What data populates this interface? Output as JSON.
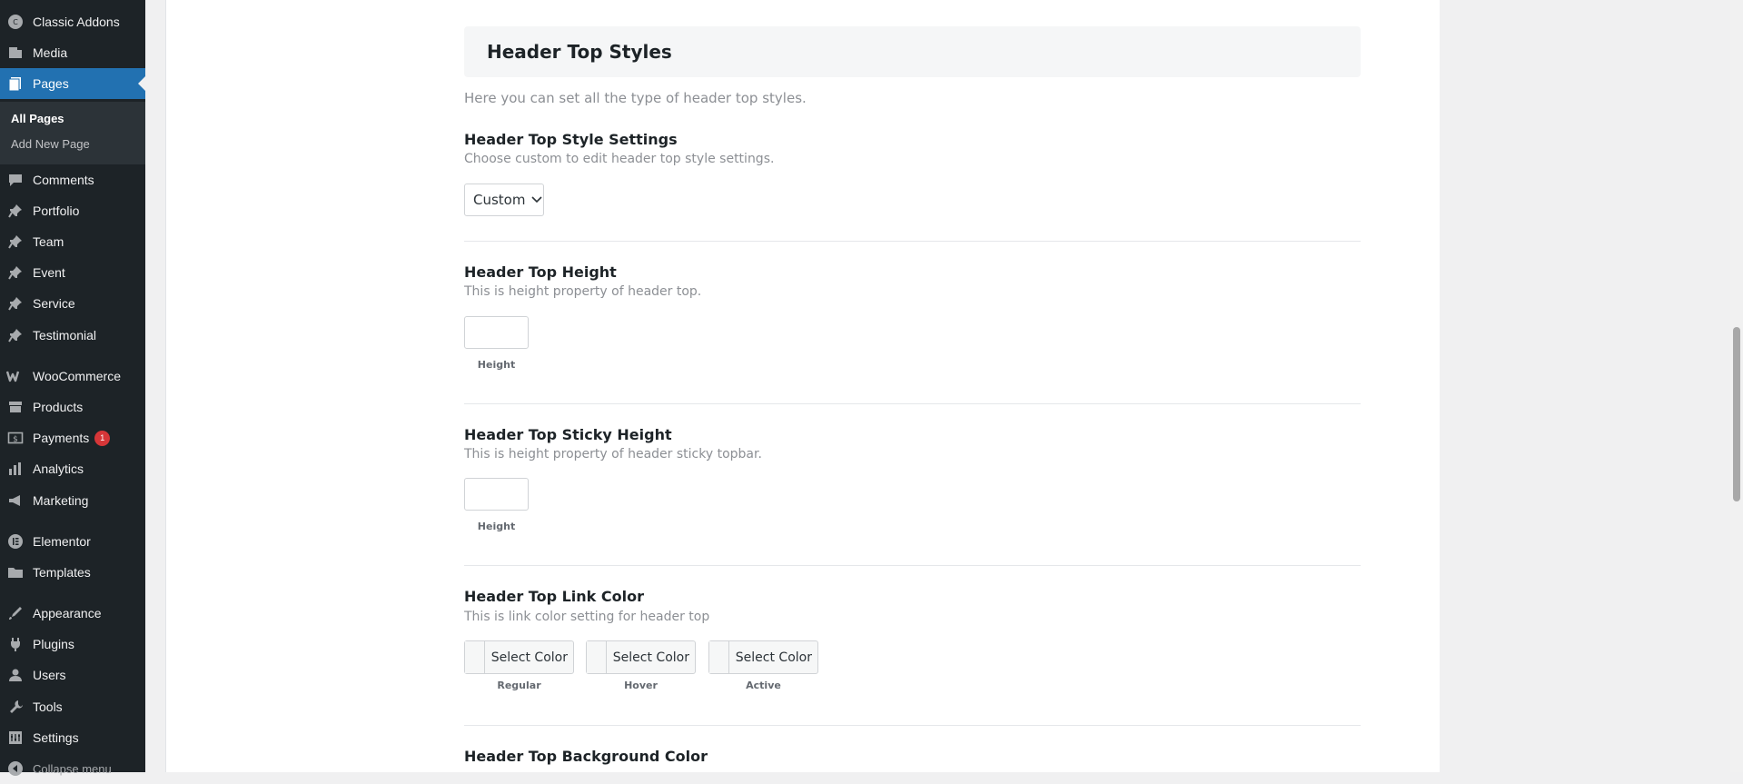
{
  "sidebar": {
    "items": [
      {
        "label": "Classic Addons",
        "icon": "classic-addons-icon"
      },
      {
        "label": "Media",
        "icon": "media-icon"
      },
      {
        "label": "Pages",
        "icon": "pages-icon",
        "active": true
      },
      {
        "label": "Comments",
        "icon": "comments-icon"
      },
      {
        "label": "Portfolio",
        "icon": "pin-icon"
      },
      {
        "label": "Team",
        "icon": "pin-icon"
      },
      {
        "label": "Event",
        "icon": "pin-icon"
      },
      {
        "label": "Service",
        "icon": "pin-icon"
      },
      {
        "label": "Testimonial",
        "icon": "pin-icon"
      },
      {
        "label": "WooCommerce",
        "icon": "woocommerce-icon"
      },
      {
        "label": "Products",
        "icon": "products-icon"
      },
      {
        "label": "Payments",
        "icon": "payments-icon",
        "badge": "1"
      },
      {
        "label": "Analytics",
        "icon": "analytics-icon"
      },
      {
        "label": "Marketing",
        "icon": "marketing-icon"
      },
      {
        "label": "Elementor",
        "icon": "elementor-icon"
      },
      {
        "label": "Templates",
        "icon": "templates-icon"
      },
      {
        "label": "Appearance",
        "icon": "appearance-icon"
      },
      {
        "label": "Plugins",
        "icon": "plugins-icon"
      },
      {
        "label": "Users",
        "icon": "users-icon"
      },
      {
        "label": "Tools",
        "icon": "tools-icon"
      },
      {
        "label": "Settings",
        "icon": "settings-icon"
      },
      {
        "label": "Collapse menu",
        "icon": "collapse-icon"
      }
    ],
    "submenu": [
      {
        "label": "All Pages",
        "current": true
      },
      {
        "label": "Add New Page"
      }
    ]
  },
  "main": {
    "section_title": "Header Top Styles",
    "section_desc": "Here you can set all the type of header top styles.",
    "style_settings": {
      "title": "Header Top Style Settings",
      "desc": "Choose custom to edit header top style settings.",
      "selected": "Custom"
    },
    "height": {
      "title": "Header Top Height",
      "desc": "This is height property of header top.",
      "input_label": "Height",
      "value": ""
    },
    "sticky_height": {
      "title": "Header Top Sticky Height",
      "desc": "This is height property of header sticky topbar.",
      "input_label": "Height",
      "value": ""
    },
    "link_color": {
      "title": "Header Top Link Color",
      "desc": "This is link color setting for header top",
      "buttons": [
        {
          "label": "Select Color",
          "state": "Regular"
        },
        {
          "label": "Select Color",
          "state": "Hover"
        },
        {
          "label": "Select Color",
          "state": "Active"
        }
      ]
    },
    "bg_color": {
      "title": "Header Top Background Color"
    }
  },
  "colors": {
    "sidebar_bg": "#1d2327",
    "active_bg": "#2271b1",
    "badge": "#d63638"
  }
}
